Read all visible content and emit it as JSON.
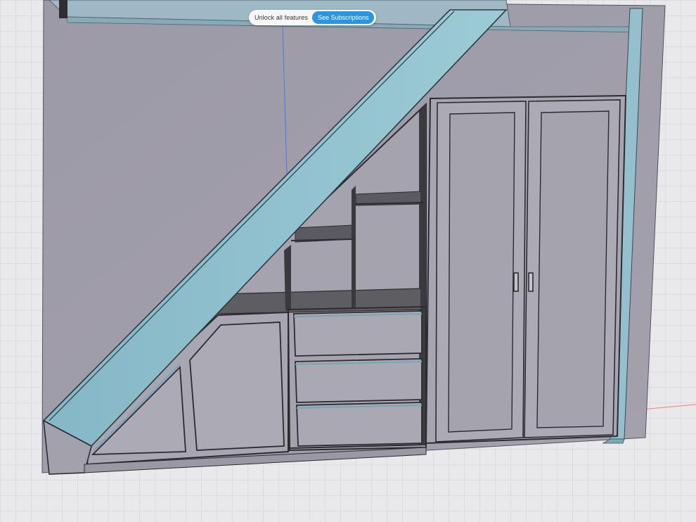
{
  "app": {
    "name": "3D modeling app viewport"
  },
  "banner": {
    "message": "Unlock all features",
    "button_label": "See Subscriptions"
  },
  "colors": {
    "background_grid": "#e9e9ec",
    "grid_line": "#c6c6cc",
    "wall": "#9c99a6",
    "cabinet_face": "#a9a7b1",
    "cabinet_edge": "#2c2c30",
    "stair_stringer": "#8fbecc",
    "stair_stringer_side": "#7aa9b8",
    "shelf_interior": "#5c5b5f",
    "banner_button": "#2a95e0",
    "axis_blue": "#3e7ee0",
    "axis_red": "#e06060"
  },
  "scene": {
    "object": "under-stair-cabinet-model",
    "components": {
      "wardrobe_doors": 2,
      "drawers": 3,
      "open_shelf_compartments": 4,
      "angled_cupboard_doors": 2
    }
  }
}
